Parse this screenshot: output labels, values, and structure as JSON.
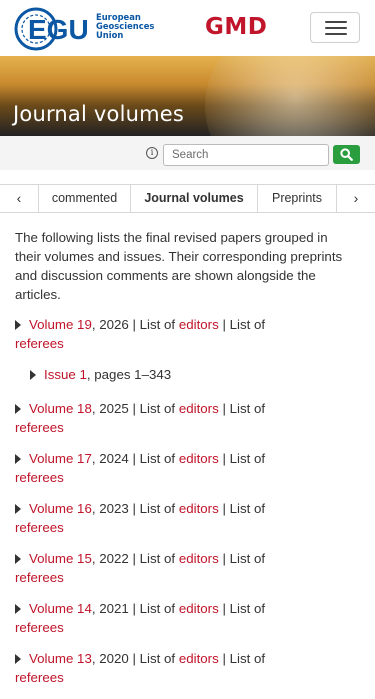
{
  "header": {
    "logo": {
      "abbr": "EGU",
      "name_lines": [
        "European",
        "Geosciences",
        "Union"
      ]
    },
    "journal": "GMD",
    "menu_icon": "hamburger-menu-icon",
    "brand_color": "#c0152a",
    "egu_color": "#0b57a4"
  },
  "banner": {
    "title": "Journal volumes"
  },
  "search": {
    "placeholder": "Search",
    "info_icon": "info-icon",
    "button_icon": "search-icon",
    "button_color": "#2a9d3f"
  },
  "tabs": {
    "prev_icon": "chevron-left-icon",
    "next_icon": "chevron-right-icon",
    "items": [
      {
        "label": "commented"
      },
      {
        "label": "Journal volumes",
        "active": true
      },
      {
        "label": "Preprints"
      }
    ],
    "prev_label": "‹",
    "next_label": "›"
  },
  "intro": "The following lists the final revised papers grouped in their volumes and issues. Their corresponding preprints and discussion comments are shown alongside the articles.",
  "volumes": [
    {
      "label": "Volume 19",
      "year": ", 2026 | List of ",
      "editors": "editors",
      "sep": " | List of",
      "referees": "referees"
    },
    {
      "label": "Volume 18",
      "year": ", 2025 | List of ",
      "editors": "editors",
      "sep": " | List of",
      "referees": "referees"
    },
    {
      "label": "Volume 17",
      "year": ", 2024 | List of ",
      "editors": "editors",
      "sep": " | List of",
      "referees": "referees"
    },
    {
      "label": "Volume 16",
      "year": ", 2023 | List of ",
      "editors": "editors",
      "sep": " | List of",
      "referees": "referees"
    },
    {
      "label": "Volume 15",
      "year": ", 2022 | List of ",
      "editors": "editors",
      "sep": " | List of",
      "referees": "referees"
    },
    {
      "label": "Volume 14",
      "year": ", 2021 | List of ",
      "editors": "editors",
      "sep": " | List of",
      "referees": "referees"
    },
    {
      "label": "Volume 13",
      "year": ", 2020 | List of ",
      "editors": "editors",
      "sep": " | List of",
      "referees": "referees"
    }
  ],
  "issue": {
    "label": "Issue 1",
    "pages": ", pages 1–343"
  }
}
